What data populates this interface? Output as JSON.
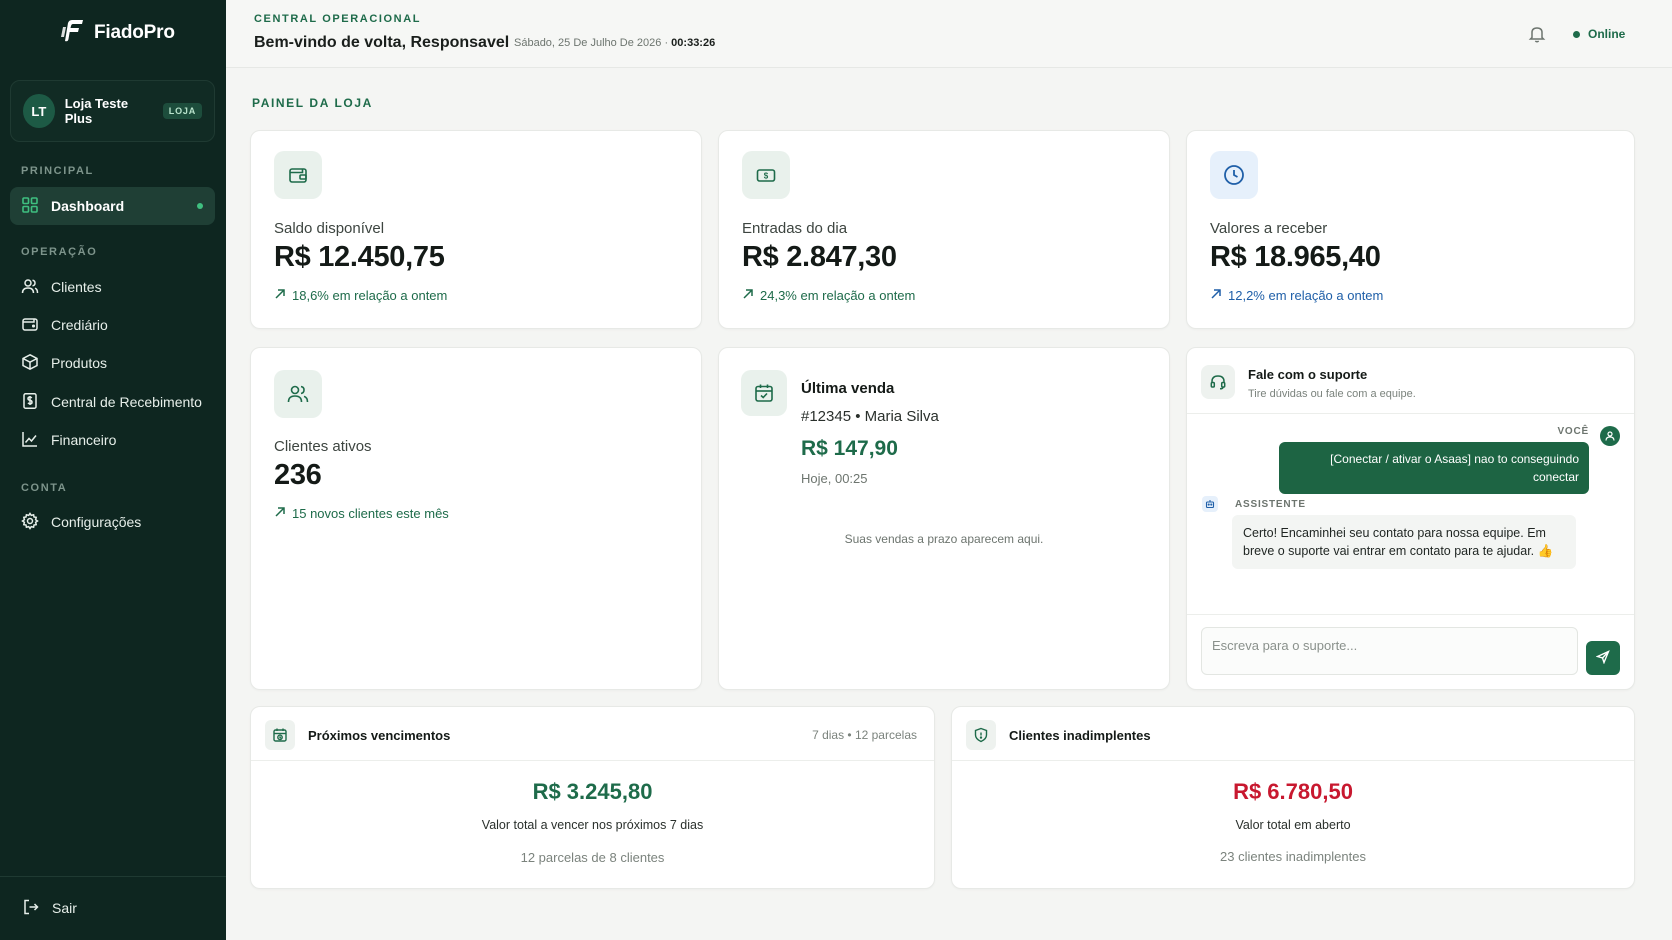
{
  "brand": {
    "name": "FiadoPro"
  },
  "store": {
    "initials": "LT",
    "name": "Loja Teste Plus",
    "badge": "LOJA"
  },
  "sidebar": {
    "sections": [
      {
        "label": "PRINCIPAL"
      },
      {
        "label": "OPERAÇÃO"
      },
      {
        "label": "CONTA"
      }
    ],
    "items": [
      {
        "label": "Dashboard",
        "icon": "grid-icon"
      },
      {
        "label": "Clientes",
        "icon": "users-icon"
      },
      {
        "label": "Crediário",
        "icon": "wallet-icon"
      },
      {
        "label": "Produtos",
        "icon": "box-icon"
      },
      {
        "label": "Central de Recebimento",
        "icon": "receipt-icon"
      },
      {
        "label": "Financeiro",
        "icon": "chart-icon"
      },
      {
        "label": "Configurações",
        "icon": "gear-icon"
      }
    ],
    "logout": "Sair"
  },
  "header": {
    "eyebrow": "CENTRAL OPERACIONAL",
    "welcome": "Bem-vindo de volta, Responsavel",
    "date": "Sábado, 25 De Julho De 2026 ·",
    "time": "00:33:26",
    "status": "Online"
  },
  "panel_title": "PAINEL DA LOJA",
  "stats": [
    {
      "label": "Saldo disponível",
      "value": "R$ 12.450,75",
      "delta": "18,6% em relação a ontem"
    },
    {
      "label": "Entradas do dia",
      "value": "R$ 2.847,30",
      "delta": "24,3% em relação a ontem"
    },
    {
      "label": "Valores a receber",
      "value": "R$ 18.965,40",
      "delta": "12,2% em relação a ontem"
    },
    {
      "label": "Clientes ativos",
      "value": "236",
      "delta": "15 novos clientes este mês"
    }
  ],
  "last_sale": {
    "title": "Última venda",
    "id": "#12345 • Maria Silva",
    "value": "R$ 147,90",
    "time": "Hoje, 00:25",
    "note": "Suas vendas a prazo aparecem aqui."
  },
  "support": {
    "title": "Fale com o suporte",
    "subtitle": "Tire dúvidas ou fale com a equipe.",
    "you_label": "VOCÊ",
    "user_message": "[Conectar / ativar o Asaas] nao to conseguindo conectar",
    "assistant_label": "ASSISTENTE",
    "assistant_message": "Certo! Encaminhei seu contato para nossa equipe. Em breve o suporte vai entrar em contato para te ajudar. 👍",
    "input_placeholder": "Escreva para o suporte..."
  },
  "upcoming": {
    "title": "Próximos vencimentos",
    "meta": "7 dias • 12 parcelas",
    "value": "R$ 3.245,80",
    "description": "Valor total a vencer nos próximos 7 dias",
    "note": "12 parcelas de 8 clientes"
  },
  "defaulters": {
    "title": "Clientes inadimplentes",
    "value": "R$ 6.780,50",
    "description": "Valor total em aberto",
    "note": "23 clientes inadimplentes"
  },
  "colors": {
    "brand_green": "#1e6b4a",
    "sidebar_bg": "#0e2620",
    "danger_red": "#c8182f",
    "accent_blue": "#1f5fa8"
  }
}
